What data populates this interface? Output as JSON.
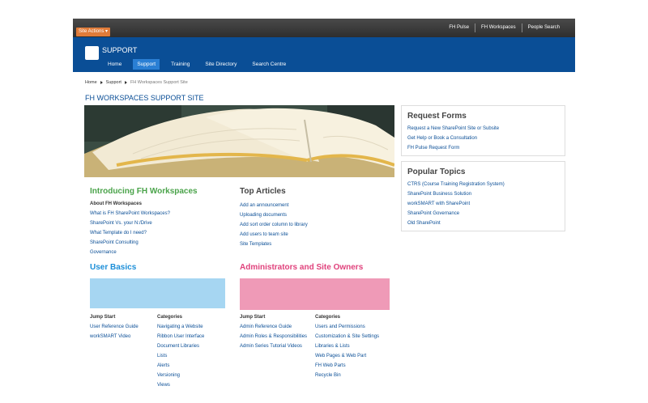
{
  "topbar": {
    "site_actions": "Site Actions ▾",
    "links": [
      "FH Pulse",
      "FH Workspaces",
      "People Search"
    ]
  },
  "header": {
    "site_title": "SUPPORT",
    "nav": [
      "Home",
      "Support",
      "Training",
      "Site Directory",
      "Search Centre"
    ],
    "active_nav": "Support"
  },
  "breadcrumb": [
    "Home",
    "Support",
    "FH Workspaces Support Site"
  ],
  "page_title": "FH WORKSPACES SUPPORT SITE",
  "intro": {
    "heading": "Introducing FH Workspaces",
    "subheading": "About FH Workspaces",
    "links": [
      "What is FH SharePoint Workspaces?",
      "SharePoint Vs. your N:/Drive",
      "What Template do I need?",
      "SharePoint Consulting",
      "Governance"
    ]
  },
  "top_articles": {
    "heading": "Top Articles",
    "links": [
      "Add an announcement",
      "Uploading documents",
      "Add sort order column to library",
      "Add users to team site",
      "Site Templates"
    ]
  },
  "user_basics": {
    "heading": "User Basics",
    "jump_start_label": "Jump Start",
    "jump_start": [
      "User Reference Guide",
      "workSMART Video"
    ],
    "categories_label": "Categories",
    "categories": [
      "Navigating a Website",
      "Ribbon User Interface",
      "Document Libraries",
      "Lists",
      "Alerts",
      "Versioning",
      "Views"
    ]
  },
  "admins": {
    "heading": "Administrators and Site Owners",
    "jump_start_label": "Jump Start",
    "jump_start": [
      "Admin Reference Guide",
      "Admin Roles & Responsibilities",
      "Admin Series Tutorial Videos"
    ],
    "categories_label": "Categories",
    "categories": [
      "Users and Permissions",
      "Customization & Site Settings",
      "Libraries & Lists",
      "Web Pages & Web Part",
      "FH Web Parts",
      "Recycle Bin"
    ]
  },
  "request_forms": {
    "heading": "Request Forms",
    "links": [
      "Request a New SharePoint Site or Subsite",
      "Get Help or Book a Consultation",
      "FH Pulse Request Form"
    ]
  },
  "popular_topics": {
    "heading": "Popular Topics",
    "links": [
      "CTRS (Course Training Registration System)",
      "SharePoint Business Solution",
      "workSMART with SharePoint",
      "SharePoint Governance",
      "Old SharePoint"
    ]
  },
  "colors": {
    "brand_blue": "#0a4e96",
    "site_actions": "#e07b39",
    "green": "#4aa34a",
    "teal": "#1b8ed8",
    "pink": "#e0427c"
  },
  "icons": {
    "logo": "site-logo-icon",
    "breadcrumb_separator": "triangle-right-icon"
  }
}
